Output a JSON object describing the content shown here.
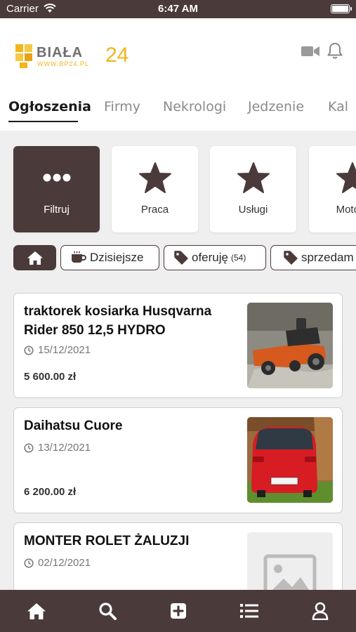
{
  "status_bar": {
    "carrier": "Carrier",
    "time": "6:47 AM"
  },
  "brand": {
    "logo_text": "BIAŁA24",
    "logo_url_text": "WWW.BP24.PL"
  },
  "tabs": [
    {
      "label": "Ogłoszenia"
    },
    {
      "label": "Firmy"
    },
    {
      "label": "Nekrologi"
    },
    {
      "label": "Jedzenie"
    },
    {
      "label": "Kal"
    }
  ],
  "categories": [
    {
      "label": "Filtruj",
      "icon": "more-dots-icon"
    },
    {
      "label": "Praca",
      "icon": "star-icon"
    },
    {
      "label": "Usługi",
      "icon": "star-icon"
    },
    {
      "label": "Motory",
      "icon": "star-icon"
    }
  ],
  "filters": {
    "today": "Dzisiejsze",
    "offer": "oferuję",
    "offer_count": "(54)",
    "sell": "sprzedam"
  },
  "listings": [
    {
      "title": "traktorek kosiarka Husqvarna Rider 850 12,5 HYDRO",
      "date": "15/12/2021",
      "price": "5 600.00 zł",
      "image": "lawn-tractor-photo"
    },
    {
      "title": "Daihatsu Cuore",
      "date": "13/12/2021",
      "price": "6 200.00 zł",
      "image": "red-car-photo"
    },
    {
      "title": "MONTER ROLET ŻALUZJI",
      "date": "02/12/2021",
      "price": "",
      "image": "placeholder-image-icon"
    }
  ],
  "colors": {
    "brand_dark": "#4a3b3a",
    "logo_yellow": "#f2b51c",
    "logo_gray": "#6f6f6f",
    "background": "#efefef"
  }
}
